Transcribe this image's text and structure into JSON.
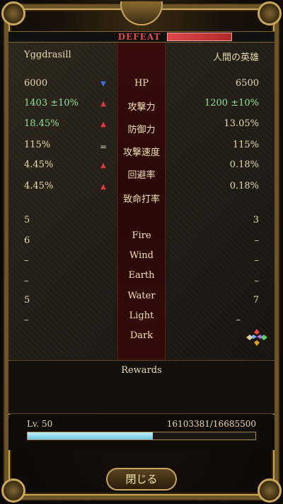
{
  "result_label": "DEFEAT",
  "player_name": "Yggdrasill",
  "enemy_name": "人間の英雄",
  "stats": [
    {
      "label": "HP",
      "left": "6000",
      "right": "6500",
      "indicator": "down",
      "left_green": false,
      "right_green": false
    },
    {
      "label": "攻撃力",
      "left": "1403 ±10%",
      "right": "1200 ±10%",
      "indicator": "up",
      "left_green": true,
      "right_green": true
    },
    {
      "label": "防御力",
      "left": "18.45%",
      "right": "13.05%",
      "indicator": "up",
      "left_green": true,
      "right_green": false
    },
    {
      "label": "攻撃速度",
      "left": "115%",
      "right": "115%",
      "indicator": "equal",
      "left_green": false,
      "right_green": false
    },
    {
      "label": "回避率",
      "left": "4.45%",
      "right": "0.18%",
      "indicator": "up",
      "left_green": false,
      "right_green": false
    },
    {
      "label": "致命打率",
      "left": "4.45%",
      "right": "0.18%",
      "indicator": "up",
      "left_green": false,
      "right_green": false
    }
  ],
  "elements": [
    {
      "label": "Fire",
      "left": "5",
      "right": "3"
    },
    {
      "label": "Wind",
      "left": "6",
      "right": "–"
    },
    {
      "label": "Earth",
      "left": "–",
      "right": "–"
    },
    {
      "label": "Water",
      "left": "–",
      "right": "–"
    },
    {
      "label": "Light",
      "left": "5",
      "right": "7"
    },
    {
      "label": "Dark",
      "left": "–",
      "right": "–"
    }
  ],
  "rewards_label": "Rewards",
  "level_label": "Lv. 50",
  "xp_text": "16103381/16685500",
  "xp_fraction": 0.55,
  "close_label": "閉じる",
  "colors": {
    "up": "#e23a3a",
    "down": "#3a6ee2",
    "green": "#8fe0a0",
    "enemy_hp": "#e04848",
    "xp": "#6ec8e6"
  },
  "icons": {
    "element_wheel": "element-wheel-icon"
  }
}
